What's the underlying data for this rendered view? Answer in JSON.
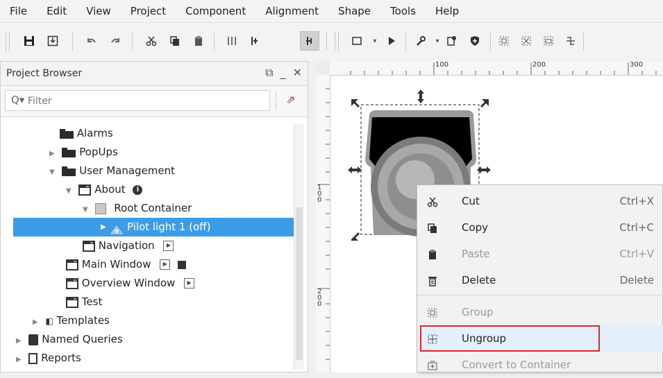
{
  "menubar": {
    "items": [
      "File",
      "Edit",
      "View",
      "Project",
      "Component",
      "Alignment",
      "Shape",
      "Tools",
      "Help"
    ]
  },
  "project_browser": {
    "title": "Project Browser",
    "filter_placeholder": "Filter",
    "tree": [
      {
        "label": "Alarms",
        "icon": "folder-icon",
        "expanded": false
      },
      {
        "label": "PopUps",
        "icon": "folder-icon",
        "expanded": false
      },
      {
        "label": "User Management",
        "icon": "folder-open-icon",
        "expanded": true
      },
      {
        "label": "About",
        "icon": "window-icon",
        "badge": "info-icon"
      },
      {
        "label": "Root Container",
        "icon": "root-container-icon"
      },
      {
        "label": "Pilot light 1 (off)",
        "icon": "pilot-light-icon",
        "selected": true
      },
      {
        "label": "Navigation",
        "icon": "window-icon",
        "badge": "play-box-icon"
      },
      {
        "label": "Main Window",
        "icon": "window-icon",
        "badge": "play-box-icon"
      },
      {
        "label": "Overview Window",
        "icon": "window-icon",
        "badge": "play-box-icon"
      },
      {
        "label": "Test",
        "icon": "window-icon"
      },
      {
        "label": "Templates",
        "icon": "templates-icon"
      },
      {
        "label": "Named Queries",
        "icon": "database-icon"
      },
      {
        "label": "Reports",
        "icon": "report-icon"
      }
    ]
  },
  "ruler": {
    "h_ticks": [
      "100",
      "200",
      "300"
    ],
    "v_ticks": [
      "100",
      "200"
    ]
  },
  "context_menu": {
    "items": [
      {
        "label": "Cut",
        "shortcut": "Ctrl+X",
        "icon": "scissors-icon",
        "enabled": true
      },
      {
        "label": "Copy",
        "shortcut": "Ctrl+C",
        "icon": "copy-icon",
        "enabled": true
      },
      {
        "label": "Paste",
        "shortcut": "Ctrl+V",
        "icon": "paste-icon",
        "enabled": false
      },
      {
        "label": "Delete",
        "shortcut": "Delete",
        "icon": "trash-icon",
        "enabled": true
      },
      {
        "label": "Group",
        "shortcut": "",
        "icon": "group-icon",
        "enabled": false
      },
      {
        "label": "Ungroup",
        "shortcut": "",
        "icon": "ungroup-icon",
        "enabled": true,
        "highlighted": true
      },
      {
        "label": "Convert to Container",
        "shortcut": "",
        "icon": "convert-icon",
        "enabled": false
      }
    ]
  },
  "colors": {
    "selection": "#3d9ce8",
    "highlight_box": "#e0282c"
  }
}
